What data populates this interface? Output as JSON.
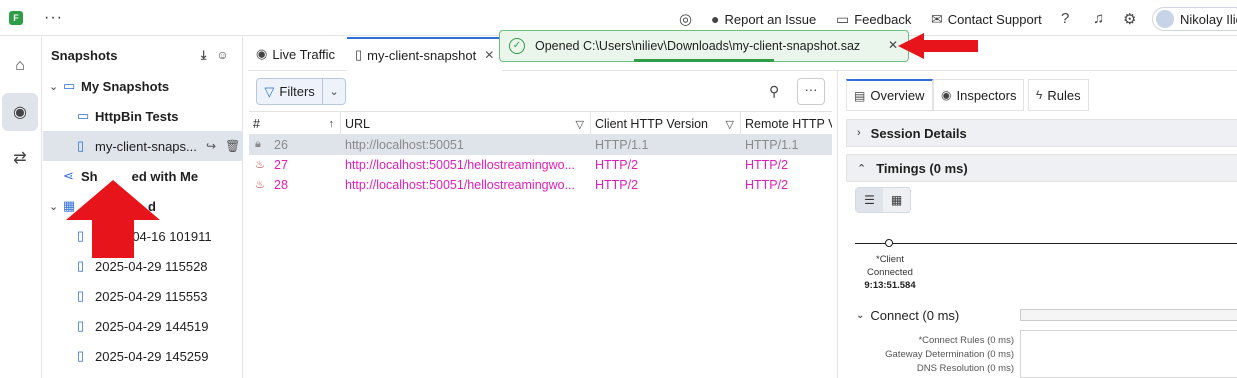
{
  "topbar": {
    "logo": "F",
    "more": "···",
    "report_issue": "Report an Issue",
    "feedback": "Feedback",
    "contact_support": "Contact Support",
    "user_name": "Nikolay Ilie"
  },
  "snapshots": {
    "title": "Snapshots",
    "my_snapshots": "My Snapshots",
    "httpbin": "HttpBin Tests",
    "selected_item": "my-client-snaps...",
    "shared_with_me": "Shared with Me",
    "shared_partial": "Sh",
    "shared_rest": "ed with Me",
    "archived_tail": "d",
    "item_1_tail": "-04-16 101911",
    "items": [
      "2025-04-29 115528",
      "2025-04-29 115553",
      "2025-04-29 144519",
      "2025-04-29 145259"
    ]
  },
  "tabs": {
    "live_traffic": "Live Traffic",
    "snapshot_tab": "my-client-snapshot"
  },
  "toast": {
    "message": "Opened C:\\Users\\niliev\\Downloads\\my-client-snapshot.saz"
  },
  "toolbar": {
    "filters": "Filters"
  },
  "grid": {
    "columns": [
      "#",
      "URL",
      "Client HTTP Version",
      "Remote HTTP V"
    ],
    "rows": [
      {
        "num": "26",
        "url": "http://localhost:50051",
        "client": "HTTP/1.1",
        "remote": "HTTP/1.1"
      },
      {
        "num": "27",
        "url": "http://localhost:50051/hellostreamingwo...",
        "client": "HTTP/2",
        "remote": "HTTP/2"
      },
      {
        "num": "28",
        "url": "http://localhost:50051/hellostreamingwo...",
        "client": "HTTP/2",
        "remote": "HTTP/2"
      }
    ]
  },
  "inspector": {
    "tabs": [
      "Overview",
      "Inspectors",
      "Rules"
    ],
    "session_details": "Session Details",
    "timings": "Timings (0 ms)",
    "timeline_label_1": "*Client",
    "timeline_label_2": "Connected",
    "timeline_time": "9:13:51.584",
    "connect": "Connect (0 ms)",
    "connect_rows": [
      "*Connect Rules (0 ms)",
      "Gateway Determination (0 ms)",
      "DNS Resolution (0 ms)"
    ]
  },
  "colors": {
    "accent": "#2f6fd6",
    "highlight_text": "#e01fb9",
    "success": "#2e9d47",
    "annotation_arrow": "#e8141c"
  }
}
